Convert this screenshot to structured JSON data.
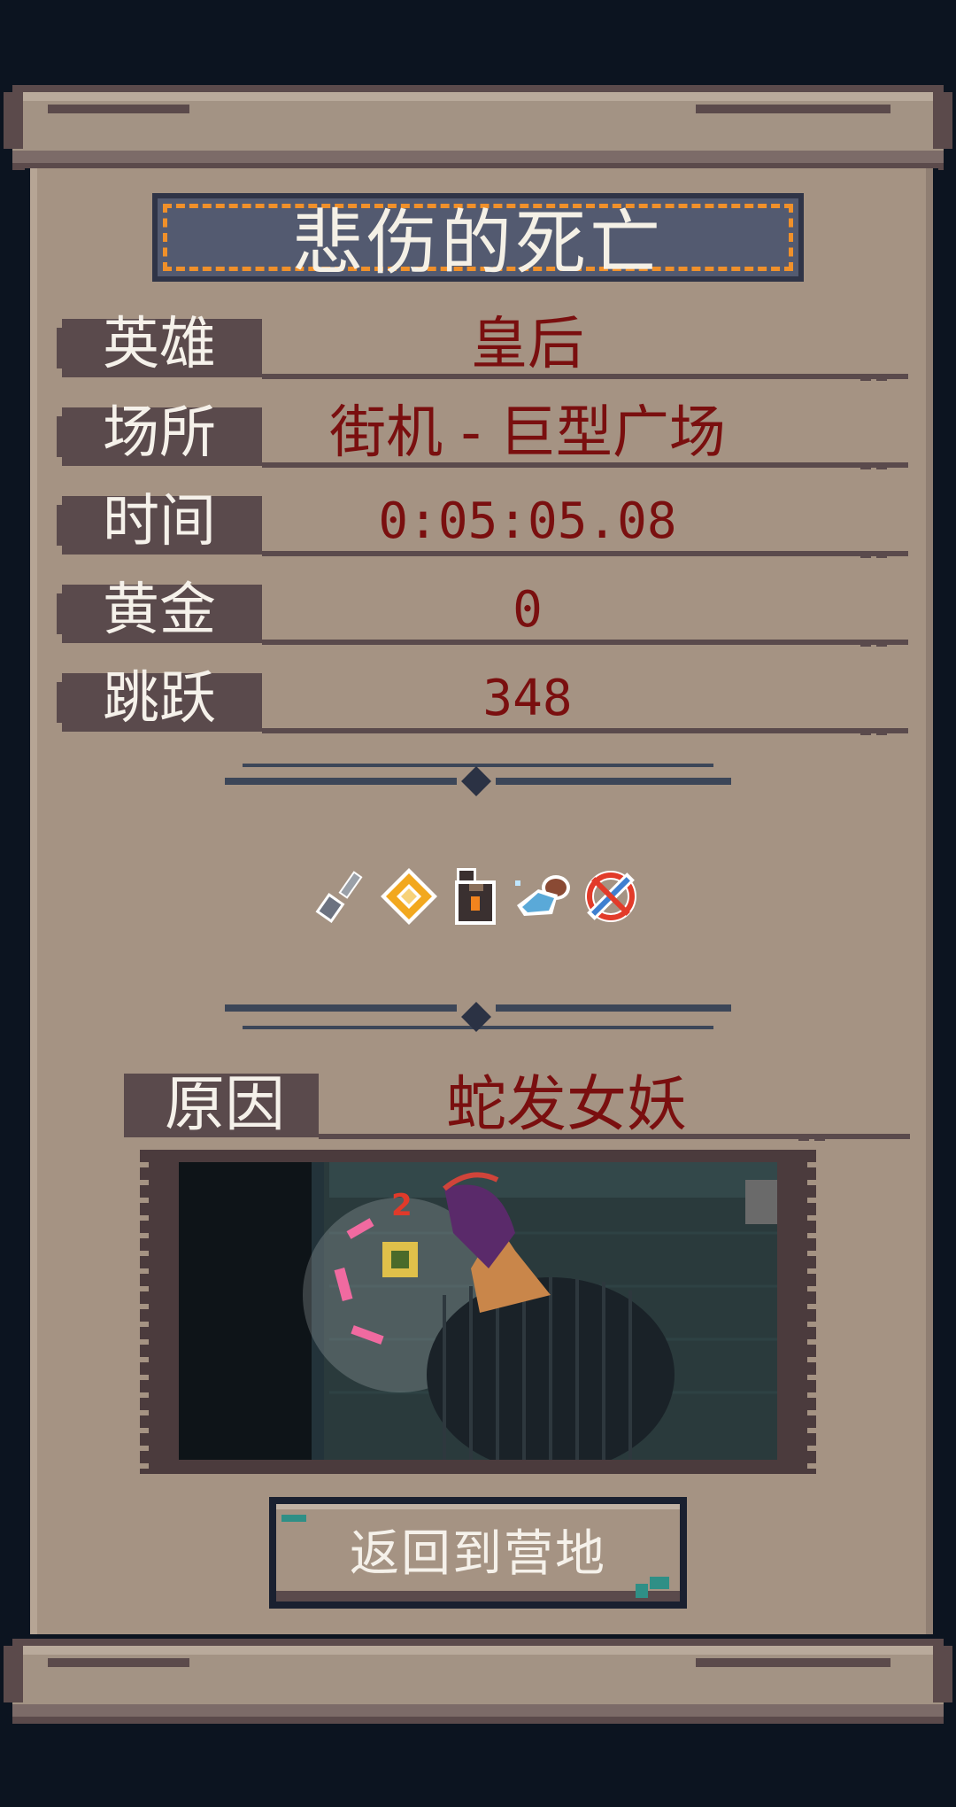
{
  "title": "悲伤的死亡",
  "stats": [
    {
      "label": "英雄",
      "value": "皇后"
    },
    {
      "label": "场所",
      "value": "街机 - 巨型广场"
    },
    {
      "label": "时间",
      "value": "0:05:05.08"
    },
    {
      "label": "黄金",
      "value": "0"
    },
    {
      "label": "跳跃",
      "value": "348"
    }
  ],
  "items": [
    "spatula-icon",
    "gold-diamond-ring-icon",
    "dark-bottle-icon",
    "winged-boot-icon",
    "crossed-out-sword-icon"
  ],
  "cause": {
    "label": "原因",
    "value": "蛇发女妖"
  },
  "death_screenshot": {
    "damage_number": "2"
  },
  "return_button": {
    "label": "返回到营地"
  },
  "colors": {
    "background": "#0c1420",
    "parchment": "#a59383",
    "label_bg": "#5a4a4c",
    "value_text": "#7a0f0f",
    "title_border": "#f0902a",
    "title_bg": "#535a70"
  }
}
